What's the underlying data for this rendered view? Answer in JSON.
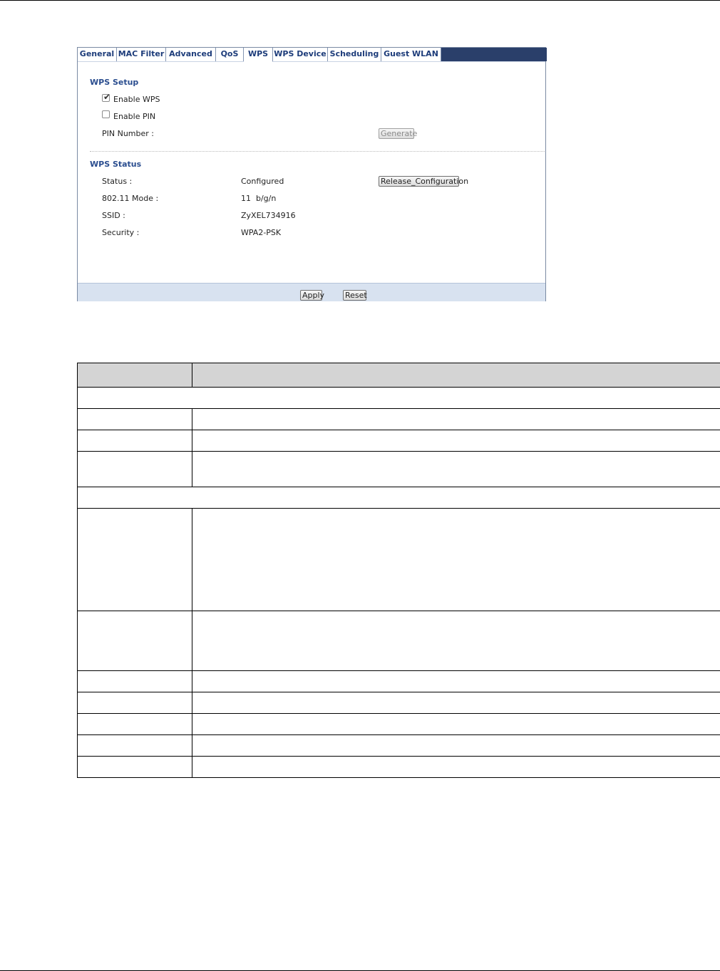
{
  "tabs": [
    {
      "label": "General",
      "active": false
    },
    {
      "label": "MAC Filter",
      "active": false
    },
    {
      "label": "Advanced",
      "active": false
    },
    {
      "label": "QoS",
      "active": false
    },
    {
      "label": "WPS",
      "active": true
    },
    {
      "label": "WPS Device",
      "active": false
    },
    {
      "label": "Scheduling",
      "active": false
    },
    {
      "label": "Guest WLAN",
      "active": false
    }
  ],
  "wps_setup": {
    "title": "WPS Setup",
    "enable_wps": {
      "label": "Enable WPS",
      "checked": true
    },
    "enable_pin": {
      "label": "Enable PIN",
      "checked": false
    },
    "pin_number_label": "PIN Number :",
    "generate_button": "Generate"
  },
  "wps_status": {
    "title": "WPS Status",
    "status_label": "Status :",
    "status_value": "Configured",
    "release_button": "Release_Configuration",
    "mode_label": "802.11 Mode :",
    "mode_value": "11  b/g/n",
    "ssid_label": "SSID :",
    "ssid_value": "ZyXEL734916",
    "security_label": "Security :",
    "security_value": "WPA2-PSK"
  },
  "footer": {
    "apply_button": "Apply",
    "reset_button": "Reset"
  },
  "colors": {
    "tab_text": "#1d3c7a",
    "tabbar_fill": "#2a3f6a",
    "section_title": "#2a4d8f",
    "footer_bg": "#d8e2f0",
    "table_header_bg": "#d4d4d4"
  }
}
